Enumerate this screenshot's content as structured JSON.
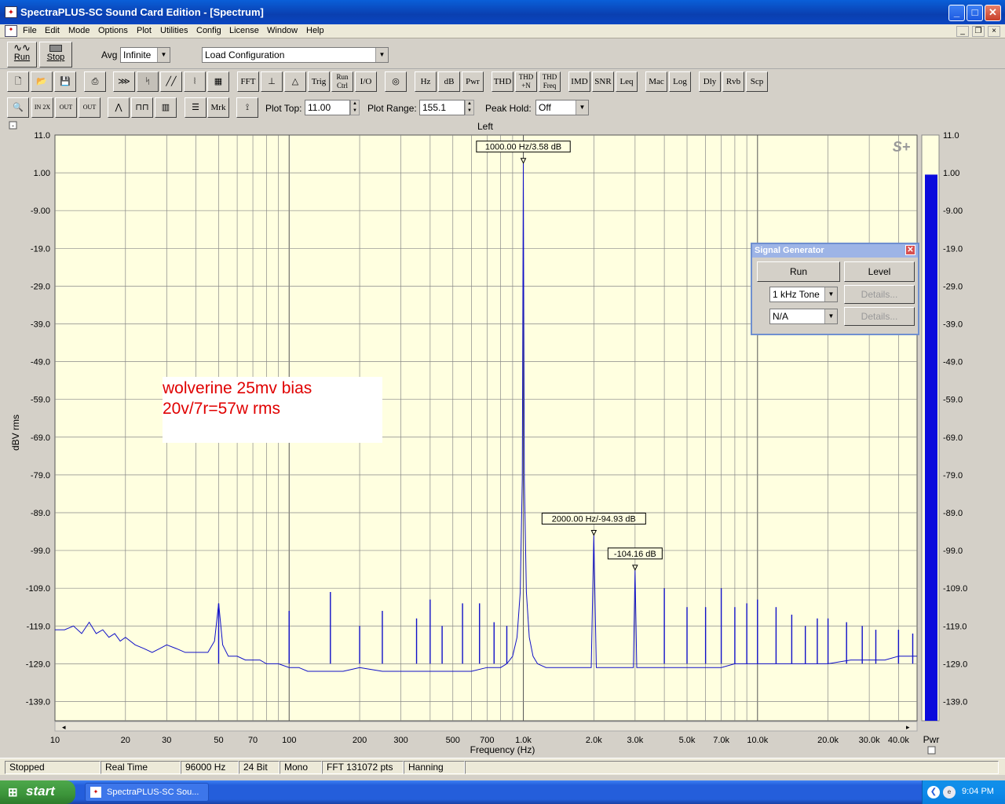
{
  "window": {
    "title": "SpectraPLUS-SC Sound Card Edition - [Spectrum]"
  },
  "menu": [
    "File",
    "Edit",
    "Mode",
    "Options",
    "Plot",
    "Utilities",
    "Config",
    "License",
    "Window",
    "Help"
  ],
  "toolbar1": {
    "run_label": "Run",
    "stop_label": "Stop",
    "avg_label": "Avg",
    "avg_value": "Infinite",
    "config_value": "Load Configuration"
  },
  "toolbar2": {
    "buttons": [
      "FFT",
      "Trig",
      "Run Ctrl",
      "I/O",
      "Hz",
      "dB",
      "Pwr",
      "THD",
      "THD +N",
      "THD Freq",
      "IMD",
      "SNR",
      "Leq",
      "Mac",
      "Log",
      "Dly",
      "Rvb",
      "Scp"
    ]
  },
  "toolbar3": {
    "mrk_label": "Mrk",
    "plot_top_label": "Plot Top:",
    "plot_top_value": "11.00",
    "plot_range_label": "Plot Range:",
    "plot_range_value": "155.1",
    "peak_hold_label": "Peak Hold:",
    "peak_hold_value": "Off"
  },
  "plot": {
    "channel": "Left",
    "logo": "S+",
    "ylabel": "dBV rms",
    "xlabel": "Frequency (Hz)",
    "meter_label": "Pwr",
    "annotation_line1": "wolverine 25mv bias",
    "annotation_line2": "20v/7r=57w rms"
  },
  "chart_data": {
    "type": "line",
    "xscale": "log",
    "xlim": [
      10,
      48000
    ],
    "ylim": [
      -144.1,
      11.0
    ],
    "y_ticks": [
      "11.0",
      "1.00",
      "-9.00",
      "-19.0",
      "-29.0",
      "-39.0",
      "-49.0",
      "-59.0",
      "-69.0",
      "-79.0",
      "-89.0",
      "-99.0",
      "-109.0",
      "-119.0",
      "-129.0",
      "-139.0"
    ],
    "x_ticks": [
      {
        "v": 10,
        "label": "10"
      },
      {
        "v": 20,
        "label": "20"
      },
      {
        "v": 30,
        "label": "30"
      },
      {
        "v": 50,
        "label": "50"
      },
      {
        "v": 70,
        "label": "70"
      },
      {
        "v": 100,
        "label": "100"
      },
      {
        "v": 200,
        "label": "200"
      },
      {
        "v": 300,
        "label": "300"
      },
      {
        "v": 500,
        "label": "500"
      },
      {
        "v": 700,
        "label": "700"
      },
      {
        "v": 1000,
        "label": "1.0k"
      },
      {
        "v": 2000,
        "label": "2.0k"
      },
      {
        "v": 3000,
        "label": "3.0k"
      },
      {
        "v": 5000,
        "label": "5.0k"
      },
      {
        "v": 7000,
        "label": "7.0k"
      },
      {
        "v": 10000,
        "label": "10.0k"
      },
      {
        "v": 20000,
        "label": "20.0k"
      },
      {
        "v": 30000,
        "label": "30.0k"
      },
      {
        "v": 40000,
        "label": "40.0k"
      }
    ],
    "markers": [
      {
        "x": 1000,
        "y": 3.58,
        "label": "1000.00 Hz/3.58 dB"
      },
      {
        "x": 2000,
        "y": -94.93,
        "label": "2000.00 Hz/-94.93 dB"
      },
      {
        "x": 3000,
        "y": -104.16,
        "label": "-104.16 dB"
      }
    ],
    "series": [
      {
        "color": "#1010c8",
        "points": [
          [
            10,
            -120
          ],
          [
            11,
            -120
          ],
          [
            12,
            -119
          ],
          [
            13,
            -121
          ],
          [
            14,
            -118
          ],
          [
            15,
            -121
          ],
          [
            16,
            -120
          ],
          [
            17,
            -122
          ],
          [
            18,
            -121
          ],
          [
            19,
            -123
          ],
          [
            20,
            -122
          ],
          [
            22,
            -124
          ],
          [
            24,
            -125
          ],
          [
            26,
            -126
          ],
          [
            28,
            -125
          ],
          [
            30,
            -124
          ],
          [
            33,
            -125
          ],
          [
            36,
            -126
          ],
          [
            40,
            -126
          ],
          [
            45,
            -126
          ],
          [
            48,
            -123
          ],
          [
            50,
            -113
          ],
          [
            52,
            -124
          ],
          [
            55,
            -127
          ],
          [
            60,
            -127
          ],
          [
            65,
            -128
          ],
          [
            70,
            -128
          ],
          [
            75,
            -128
          ],
          [
            80,
            -129
          ],
          [
            90,
            -129
          ],
          [
            100,
            -130
          ],
          [
            110,
            -130
          ],
          [
            120,
            -131
          ],
          [
            130,
            -131
          ],
          [
            150,
            -131
          ],
          [
            170,
            -131
          ],
          [
            200,
            -130
          ],
          [
            250,
            -131
          ],
          [
            300,
            -131
          ],
          [
            400,
            -131
          ],
          [
            500,
            -131
          ],
          [
            600,
            -131
          ],
          [
            700,
            -130
          ],
          [
            800,
            -130
          ],
          [
            850,
            -129
          ],
          [
            900,
            -127
          ],
          [
            940,
            -122
          ],
          [
            970,
            -110
          ],
          [
            990,
            -80
          ],
          [
            1000,
            3.58
          ],
          [
            1010,
            -80
          ],
          [
            1030,
            -110
          ],
          [
            1060,
            -122
          ],
          [
            1100,
            -127
          ],
          [
            1150,
            -129
          ],
          [
            1250,
            -130
          ],
          [
            1400,
            -130
          ],
          [
            1600,
            -130
          ],
          [
            1800,
            -130
          ],
          [
            1950,
            -130
          ],
          [
            2000,
            -94.93
          ],
          [
            2050,
            -130
          ],
          [
            2300,
            -130
          ],
          [
            2700,
            -130
          ],
          [
            2950,
            -130
          ],
          [
            3000,
            -104.16
          ],
          [
            3050,
            -130
          ],
          [
            3500,
            -130
          ],
          [
            4000,
            -130
          ],
          [
            5000,
            -130
          ],
          [
            6000,
            -130
          ],
          [
            7000,
            -130
          ],
          [
            8000,
            -129
          ],
          [
            10000,
            -129
          ],
          [
            12000,
            -129
          ],
          [
            15000,
            -129
          ],
          [
            20000,
            -129
          ],
          [
            25000,
            -128
          ],
          [
            30000,
            -128
          ],
          [
            35000,
            -128
          ],
          [
            40000,
            -127
          ],
          [
            45000,
            -127
          ],
          [
            48000,
            -127
          ]
        ]
      }
    ],
    "harmonic_spurs": [
      {
        "x": 50,
        "y": -113
      },
      {
        "x": 100,
        "y": -115
      },
      {
        "x": 150,
        "y": -110
      },
      {
        "x": 200,
        "y": -119
      },
      {
        "x": 250,
        "y": -115
      },
      {
        "x": 350,
        "y": -117
      },
      {
        "x": 400,
        "y": -112
      },
      {
        "x": 450,
        "y": -119
      },
      {
        "x": 550,
        "y": -113
      },
      {
        "x": 650,
        "y": -113
      },
      {
        "x": 750,
        "y": -118
      },
      {
        "x": 850,
        "y": -119
      },
      {
        "x": 4000,
        "y": -109
      },
      {
        "x": 5000,
        "y": -114
      },
      {
        "x": 6000,
        "y": -114
      },
      {
        "x": 7000,
        "y": -109
      },
      {
        "x": 8000,
        "y": -114
      },
      {
        "x": 9000,
        "y": -113
      },
      {
        "x": 10000,
        "y": -112
      },
      {
        "x": 12000,
        "y": -114
      },
      {
        "x": 14000,
        "y": -116
      },
      {
        "x": 16000,
        "y": -119
      },
      {
        "x": 18000,
        "y": -117
      },
      {
        "x": 20000,
        "y": -117
      },
      {
        "x": 24000,
        "y": -118
      },
      {
        "x": 28000,
        "y": -119
      },
      {
        "x": 32000,
        "y": -120
      },
      {
        "x": 40000,
        "y": -120
      },
      {
        "x": 46000,
        "y": -121
      }
    ]
  },
  "meter": {
    "level": 0.94,
    "color": "#0b0bdc"
  },
  "siggen": {
    "title": "Signal Generator",
    "run_label": "Run",
    "level_label": "Level",
    "tone_value": "1 kHz Tone",
    "na_value": "N/A",
    "details1_label": "Details...",
    "details2_label": "Details..."
  },
  "status": [
    "Stopped",
    "Real Time",
    "96000 Hz",
    "24 Bit",
    "Mono",
    "FFT 131072 pts",
    "Hanning"
  ],
  "taskbar": {
    "start_label": "start",
    "task_label": "SpectraPLUS-SC Sou...",
    "clock": "9:04 PM"
  }
}
